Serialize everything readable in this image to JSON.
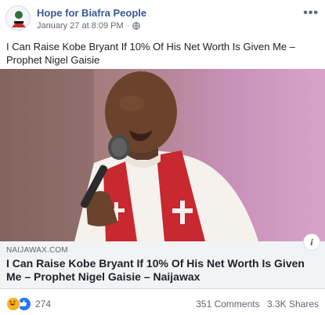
{
  "post": {
    "page_name": "Hope for Biafra People",
    "timestamp": "January 27 at 8:09 PM",
    "separator": "·",
    "text": "I Can Raise Kobe Bryant If 10% Of His Net Worth Is Given Me – Prophet Nigel Gaisie",
    "more_label": "•••"
  },
  "link": {
    "domain": "NAIJAWAX.COM",
    "title": "I Can Raise Kobe Bryant If 10% Of His Net Worth Is Given Me – Prophet Nigel Gaisie – Naijawax",
    "info_label": "i"
  },
  "footer": {
    "reaction_count": "274",
    "comments": "351 Comments",
    "shares": "3.3K Shares"
  },
  "colors": {
    "page_name": "#385898",
    "like_blue": "#2078f4",
    "haha_yellow": "#f7b125"
  },
  "icons": {
    "avatar": "page-avatar",
    "privacy": "globe-icon",
    "more": "more-options-icon",
    "info": "info-icon",
    "reactions": [
      "haha-icon",
      "like-icon"
    ]
  }
}
